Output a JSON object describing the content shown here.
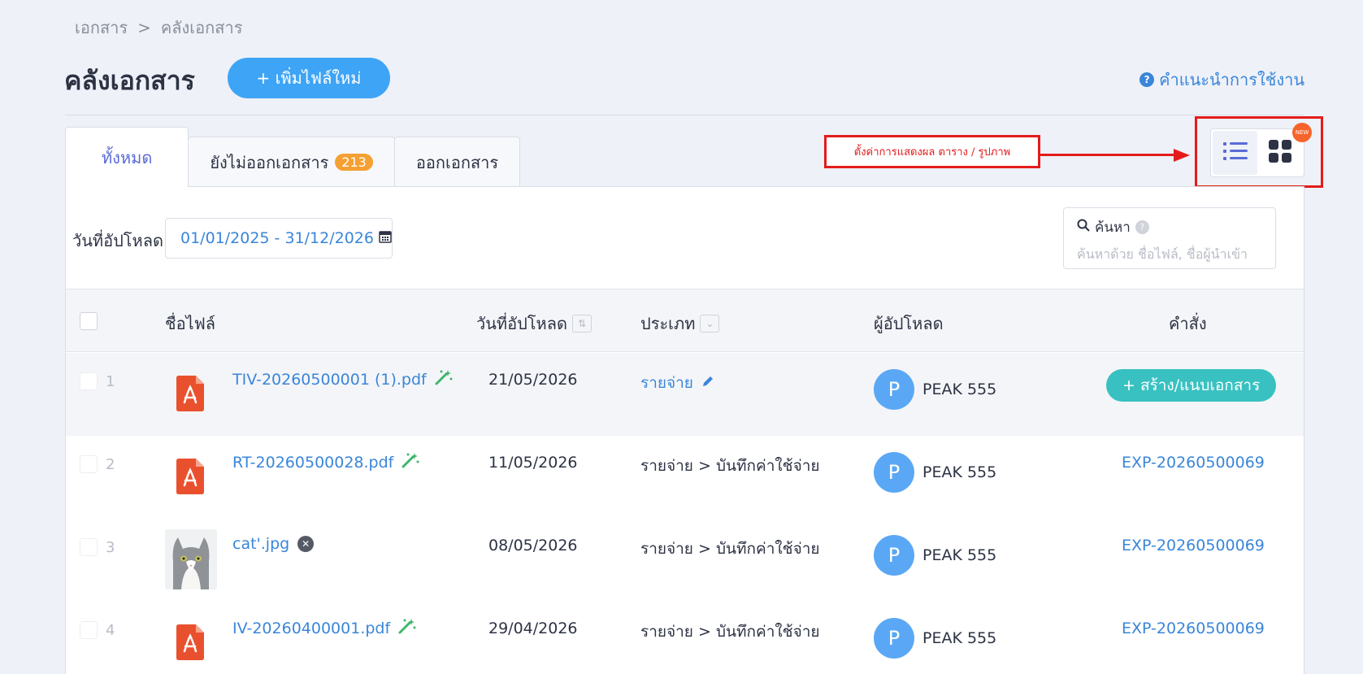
{
  "breadcrumb": {
    "root": "เอกสาร",
    "separator": ">",
    "current": "คลังเอกสาร"
  },
  "header": {
    "title": "คลังเอกสาร",
    "add_button": "+ เพิ่มไฟล์ใหม่",
    "help": "คำแนะนำการใช้งาน"
  },
  "tabs": [
    {
      "label": "ทั้งหมด",
      "active": true
    },
    {
      "label": "ยังไม่ออกเอกสาร",
      "badge": "213"
    },
    {
      "label": "ออกเอกสาร"
    }
  ],
  "annotation": {
    "text": "ตั้งค่าการแสดงผล ตาราง / รูปภาพ"
  },
  "view_toggle": {
    "new_badge": "NEW",
    "options": [
      "list-icon",
      "grid-icon"
    ],
    "active": "list"
  },
  "filters": {
    "date_label": "วันที่อัปโหลด",
    "date_range": "01/01/2025 - 31/12/2026",
    "search_label": "ค้นหา",
    "search_placeholder": "ค้นหาด้วย ชื่อไฟล์, ชื่อผู้นำเข้า"
  },
  "table": {
    "columns": [
      "ชื่อไฟล์",
      "วันที่อัปโหลด",
      "ประเภท",
      "ผู้อัปโหลด",
      "คำสั่ง"
    ],
    "rows": [
      {
        "num": "1",
        "file": "TIV-20260500001 (1).pdf",
        "date": "21/05/2026",
        "type": "รายจ่าย",
        "uploader": "PEAK 555",
        "avatar": "P",
        "action": "+ สร้าง/แนบเอกสาร"
      },
      {
        "num": "2",
        "file": "RT-20260500028.pdf",
        "date": "11/05/2026",
        "type": "รายจ่าย > บันทึกค่าใช้จ่าย",
        "uploader": "PEAK 555",
        "avatar": "P",
        "action": "EXP-20260500069"
      },
      {
        "num": "3",
        "file": "cat'.jpg",
        "date": "08/05/2026",
        "type": "รายจ่าย > บันทึกค่าใช้จ่าย",
        "uploader": "PEAK 555",
        "avatar": "P",
        "action": "EXP-20260500069"
      },
      {
        "num": "4",
        "file": "IV-20260400001.pdf",
        "date": "29/04/2026",
        "type": "รายจ่าย > บันทึกค่าใช้จ่าย",
        "uploader": "PEAK 555",
        "avatar": "P",
        "action": "EXP-20260500069"
      }
    ]
  },
  "colors": {
    "accent": "#3ea4f5",
    "link": "#3a86d9",
    "teal": "#39c1c1",
    "pdf": "#e9512e",
    "annotation": "#e41b1b",
    "badge": "#f5a033"
  }
}
